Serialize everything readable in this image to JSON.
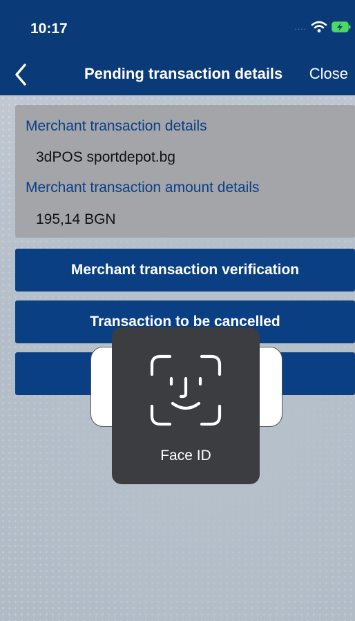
{
  "status_bar": {
    "time": "10:17",
    "signal_dots": "....",
    "icons": [
      "wifi-icon",
      "battery-charging-icon"
    ]
  },
  "nav": {
    "back_icon": "chevron-left-icon",
    "title": "Pending transaction details",
    "close_label": "Close"
  },
  "details": {
    "merchant_label": "Merchant transaction details",
    "merchant_value": "3dPOS sportdepot.bg",
    "amount_label": "Merchant transaction amount details",
    "amount_value": "195,14 BGN"
  },
  "actions": {
    "verification_label": "Merchant transaction verification",
    "cancel_label": "Transaction to be cancelled",
    "third_label": ""
  },
  "face_id": {
    "icon": "face-id-icon",
    "label": "Face ID"
  },
  "colors": {
    "header": "#0b3a78",
    "button": "#0b3f84",
    "label": "#0b3e86",
    "card": "#a3a5a8",
    "face_id_bg": "#3b3d41"
  }
}
